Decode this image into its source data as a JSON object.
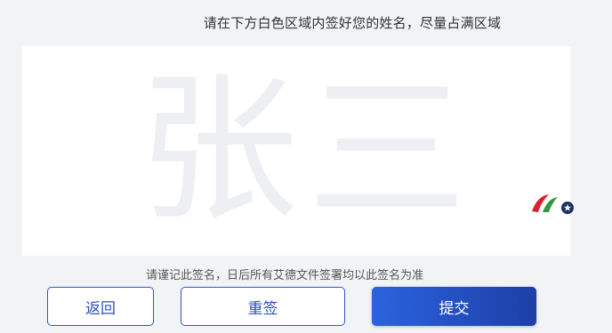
{
  "instruction": "请在下方白色区域内签好您的姓名，尽量占满区域",
  "signature_pad": {
    "placeholder_name": "张三"
  },
  "notice": "请谨记此签名，日后所有艾德文件签署均以此签名为准",
  "buttons": {
    "back_label": "返回",
    "reset_label": "重签",
    "submit_label": "提交"
  },
  "colors": {
    "accent": "#2b4fbf",
    "submit_gradient_start": "#2b63e0",
    "submit_gradient_end": "#1d3fa5",
    "logo_red": "#d9222a",
    "logo_green": "#2e9a3c",
    "logo_navy": "#1f2d6b"
  },
  "icons": {
    "brand_logo": "brand-logo-icon"
  }
}
